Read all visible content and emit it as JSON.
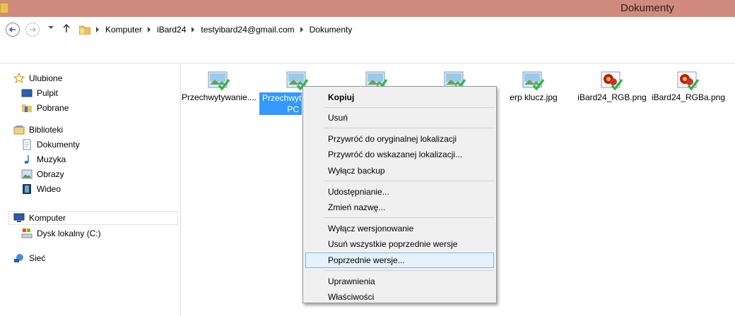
{
  "window": {
    "title": "Dokumenty"
  },
  "address": {
    "crumbs": [
      "Komputer",
      "iBard24",
      "testyibard24@gmail.com",
      "Dokumenty"
    ]
  },
  "nav": {
    "favorites": {
      "label": "Ulubione",
      "items": [
        "Pulpit",
        "Pobrane"
      ]
    },
    "libraries": {
      "label": "Biblioteki",
      "items": [
        "Dokumenty",
        "Muzyka",
        "Obrazy",
        "Wideo"
      ]
    },
    "computer": {
      "label": "Komputer",
      "items": [
        "Dysk lokalny (C:)"
      ]
    },
    "network": {
      "label": "Sieć"
    }
  },
  "files": [
    {
      "name": "Przechwytywanie....",
      "type": "image",
      "selected": false
    },
    {
      "name": "Przechwyt",
      "name2": "PC",
      "type": "image",
      "selected": true
    },
    {
      "name": "",
      "type": "image",
      "selected": false
    },
    {
      "name": "",
      "type": "image",
      "selected": false
    },
    {
      "name": "erp klucz.jpg",
      "type": "image",
      "selected": false
    },
    {
      "name": "iBard24_RGB.png",
      "type": "flower",
      "selected": false
    },
    {
      "name": "iBard24_RGBa.png",
      "type": "flower",
      "selected": false
    }
  ],
  "context_menu": {
    "groups": [
      [
        "Kopiuj"
      ],
      [
        "Usuń"
      ],
      [
        "Przywróć do oryginalnej lokalizacji",
        "Przywróć do wskazanej lokalizacji...",
        "Wyłącz backup"
      ],
      [
        "Udostępnianie...",
        "Zmień nazwę..."
      ],
      [
        "Wyłącz wersjonowanie",
        "Usuń wszystkie poprzednie wersje",
        "Poprzednie wersje..."
      ],
      [
        "Uprawnienia",
        "Właściwości"
      ]
    ],
    "highlighted": "Poprzednie wersje..."
  },
  "colors": {
    "titlebar": "#d08a7e",
    "selection": "#3399ff",
    "menu_highlight": "#e5f1fb",
    "check_green": "#2fb54a"
  }
}
